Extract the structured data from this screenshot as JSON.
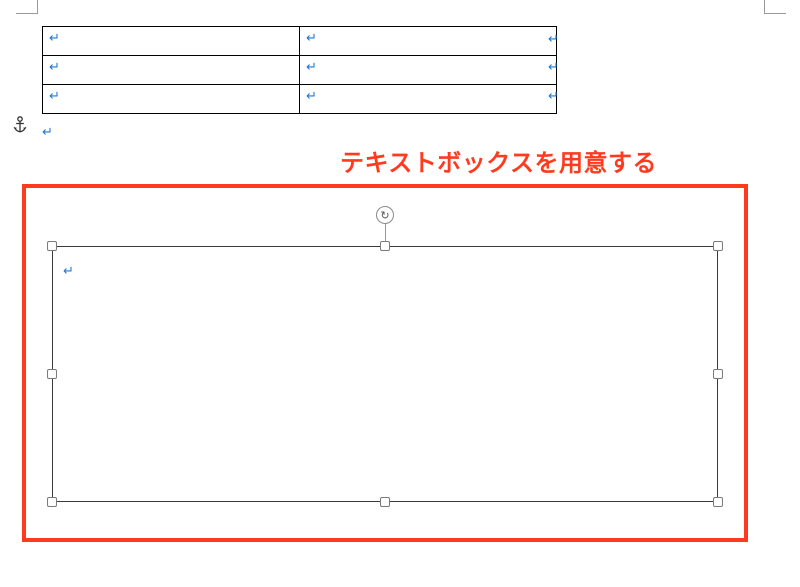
{
  "marks": {
    "paragraph": "↵"
  },
  "table": {
    "rows": [
      {
        "c1": "↵",
        "c2": "↵"
      },
      {
        "c1": "↵",
        "c2": "↵"
      },
      {
        "c1": "↵",
        "c2": "↵"
      }
    ],
    "trailing": [
      "↵",
      "↵",
      "↵"
    ]
  },
  "after_table_mark": "↵",
  "annotation": "テキストボックスを用意する",
  "textbox": {
    "content_mark": "↵"
  },
  "rotation_glyph": "↻"
}
